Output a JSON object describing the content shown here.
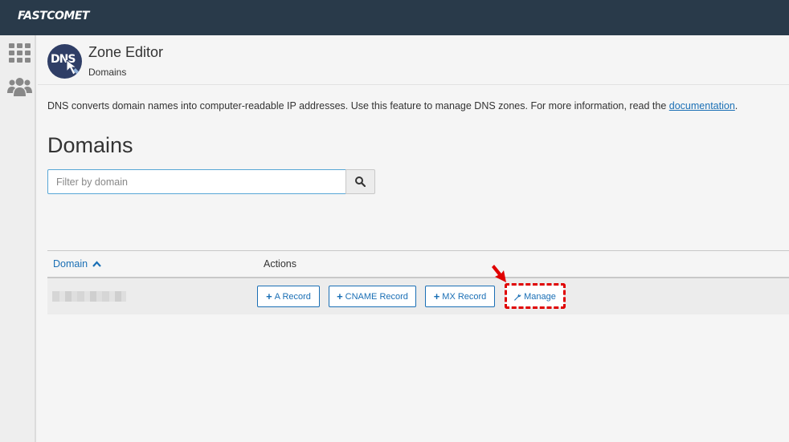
{
  "brand": {
    "name": "FASTCOMET"
  },
  "sidebar": {
    "items": [
      {
        "icon": "grid-icon"
      },
      {
        "icon": "users-icon"
      }
    ]
  },
  "header": {
    "logo_text": "DNS",
    "title": "Zone Editor",
    "subtitle": "Domains"
  },
  "description": {
    "text": "DNS converts domain names into computer-readable IP addresses. Use this feature to manage DNS zones. For more information, read the ",
    "link": "documentation",
    "suffix": "."
  },
  "page_title": "Domains",
  "filter": {
    "placeholder": "Filter by domain",
    "value": ""
  },
  "table": {
    "columns": [
      {
        "label": "Domain",
        "sort": "ascending"
      },
      {
        "label": "Actions"
      }
    ],
    "rows": [
      {
        "domain": "",
        "actions": {
          "a_record": "A Record",
          "cname_record": "CNAME Record",
          "mx_record": "MX Record",
          "manage": "Manage"
        }
      }
    ]
  },
  "colors": {
    "topbar": "#293a4a",
    "accent": "#1a6fb5",
    "highlight": "#e00000"
  }
}
